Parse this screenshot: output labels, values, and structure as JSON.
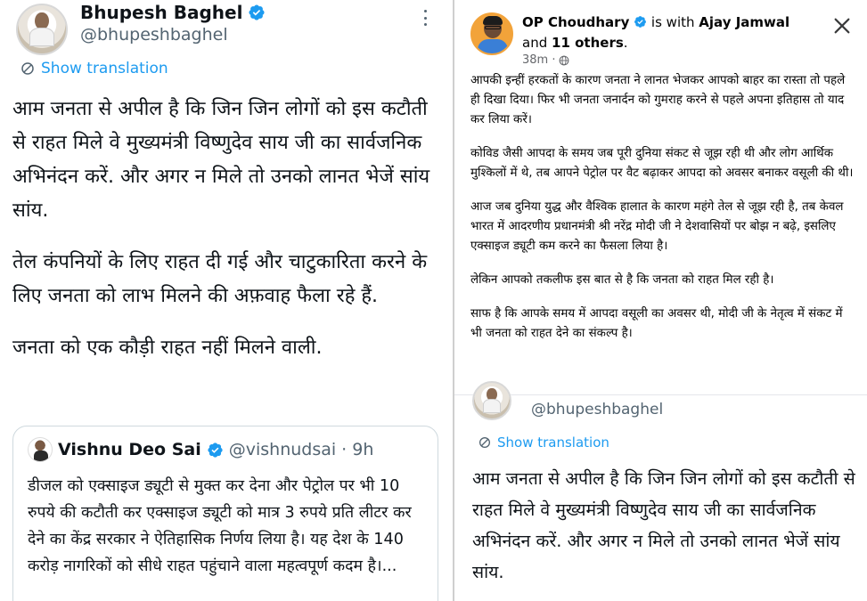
{
  "left_tweet": {
    "author_name": "Bhupesh Baghel",
    "author_handle": "@bhupeshbaghel",
    "show_translation": "Show translation",
    "paragraphs": [
      "आम जनता से अपील है कि जिन जिन लोगों को इस कटौती से राहत मिले वे मुख्यमंत्री विष्णुदेव साय जी का सार्वजनिक अभिनंदन करें. और अगर न मिले तो उनको लानत भेजें सांय सांय.",
      "तेल कंपनियों के लिए राहत दी गई और चाटुकारिता करने के लिए जनता को लाभ मिलने की अफ़वाह फैला रहे हैं.",
      "जनता को एक कौड़ी राहत नहीं मिलने वाली."
    ],
    "quoted": {
      "author_name": "Vishnu Deo Sai",
      "author_handle": "@vishnudsai",
      "time": "· 9h",
      "text": "डीजल को एक्साइज ड्यूटी से मुक्त कर देना और पेट्रोल पर भी 10 रुपये की कटौती कर एक्साइज ड्यूटी को मात्र 3 रुपये प्रति लीटर कर देने का केंद्र सरकार ने ऐतिहासिक निर्णय लिया है। यह देश के 140 करोड़ नागरिकों को सीधे राहत पहुंचाने वाला महत्वपूर्ण कदम है।..."
    }
  },
  "fb_post": {
    "author_name": "OP Choudhary",
    "with_text": "is with",
    "tagged_name": "Ajay Jamwal",
    "and_text": "and",
    "others": "11 others",
    "time": "38m ·",
    "paragraphs": [
      "आपकी इन्हीं हरकतों के कारण जनता ने लानत भेजकर आपको बाहर का रास्ता तो पहले ही दिखा दिया। फिर भी जनता जनार्दन को गुमराह करने से पहले अपना इतिहास तो याद कर लिया करें।",
      "कोविड जैसी आपदा के समय जब पूरी दुनिया संकट से जूझ रही थी और लोग आर्थिक मुश्किलों में थे, तब आपने पेट्रोल पर वैट बढ़ाकर आपदा को अवसर बनाकर वसूली की थी।",
      "आज जब दुनिया युद्ध और वैश्विक हालात के कारण महंगे तेल से जूझ रही है, तब केवल भारत में आदरणीय प्रधानमंत्री श्री नरेंद्र मोदी जी ने देशवासियों पर बोझ न बढ़े, इसलिए एक्साइज ड्यूटी कम करने का फैसला लिया है।",
      "लेकिन आपको तकलीफ इस बात से है कि जनता को राहत मिल रही है।",
      "साफ है कि आपके समय में आपदा वसूली का अवसर थी, मोदी जी के नेतृत्व में संकट में भी जनता को राहत देने का संकल्प है।"
    ]
  },
  "right_tweet": {
    "author_handle": "@bhupeshbaghel",
    "show_translation": "Show translation",
    "text": "आम जनता से अपील है कि जिन जिन लोगों को इस कटौती से राहत मिले वे मुख्यमंत्री विष्णुदेव साय जी का सार्वजनिक अभिनंदन करें. और अगर न मिले तो उनको लानत भेजें सांय सांय."
  },
  "colors": {
    "link_blue": "#1d9bf0",
    "verified_blue": "#1d9bf0",
    "text_dark": "#0f1419",
    "muted_gray": "#536471",
    "fb_meta_gray": "#65676b"
  },
  "icons": [
    "verified-badge-icon",
    "translate-icon",
    "more-options-icon",
    "globe-icon",
    "close-icon"
  ]
}
